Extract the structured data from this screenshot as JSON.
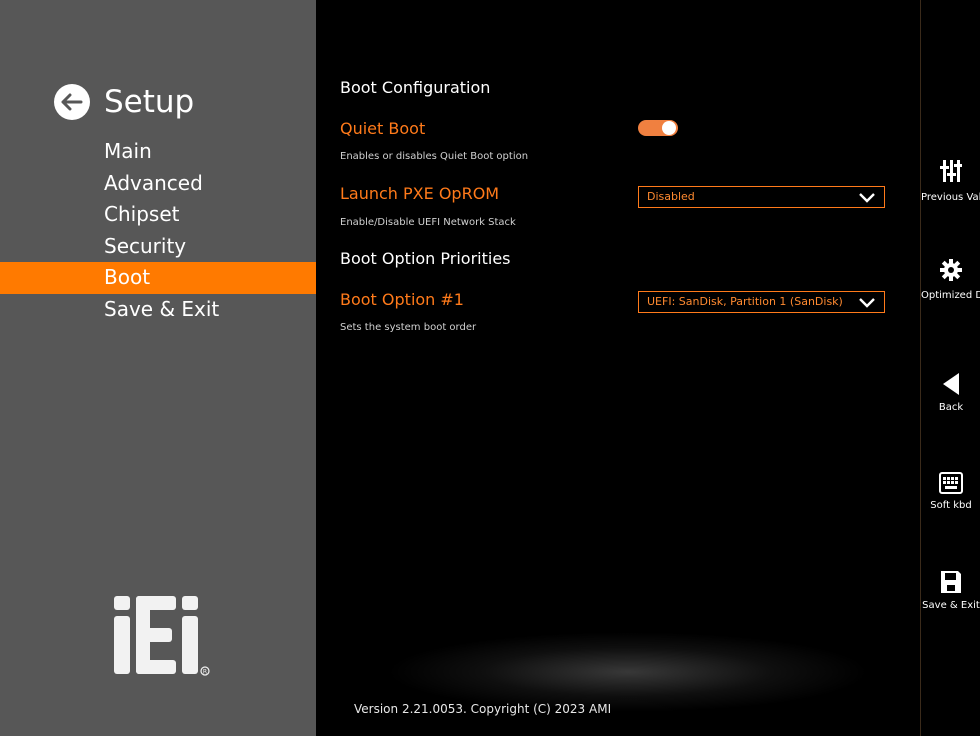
{
  "sidebar": {
    "title": "Setup",
    "items": [
      {
        "label": "Main",
        "active": false
      },
      {
        "label": "Advanced",
        "active": false
      },
      {
        "label": "Chipset",
        "active": false
      },
      {
        "label": "Security",
        "active": false
      },
      {
        "label": "Boot",
        "active": true
      },
      {
        "label": "Save & Exit",
        "active": false
      }
    ],
    "logo_text": "iEi"
  },
  "main": {
    "section_boot_config": "Boot Configuration",
    "quiet_boot": {
      "label": "Quiet Boot",
      "help": "Enables or disables Quiet Boot option",
      "value": "on"
    },
    "launch_pxe": {
      "label": "Launch PXE OpROM",
      "help": "Enable/Disable UEFI Network Stack",
      "value": "Disabled"
    },
    "section_priorities": "Boot Option Priorities",
    "boot_option1": {
      "label": "Boot Option #1",
      "help": "Sets the system boot order",
      "value": "UEFI: SanDisk, Partition 1 (SanDisk)"
    },
    "version": "Version 2.21.0053. Copyright (C) 2023 AMI"
  },
  "rail": {
    "tools": [
      {
        "name": "previous-values",
        "label": "Previous Values",
        "icon": "sliders-icon"
      },
      {
        "name": "optimized-defaults",
        "label": "Optimized Defaults",
        "icon": "gear-icon"
      },
      {
        "name": "back",
        "label": "Back",
        "icon": "back-triangle-icon"
      },
      {
        "name": "soft-kbd",
        "label": "Soft kbd",
        "icon": "keyboard-icon"
      },
      {
        "name": "save-exit",
        "label": "Save & Exit",
        "icon": "save-icon"
      }
    ]
  },
  "colors": {
    "accent": "#ff7a00",
    "sidebar_bg": "#575757",
    "toggle": "#f08040"
  }
}
